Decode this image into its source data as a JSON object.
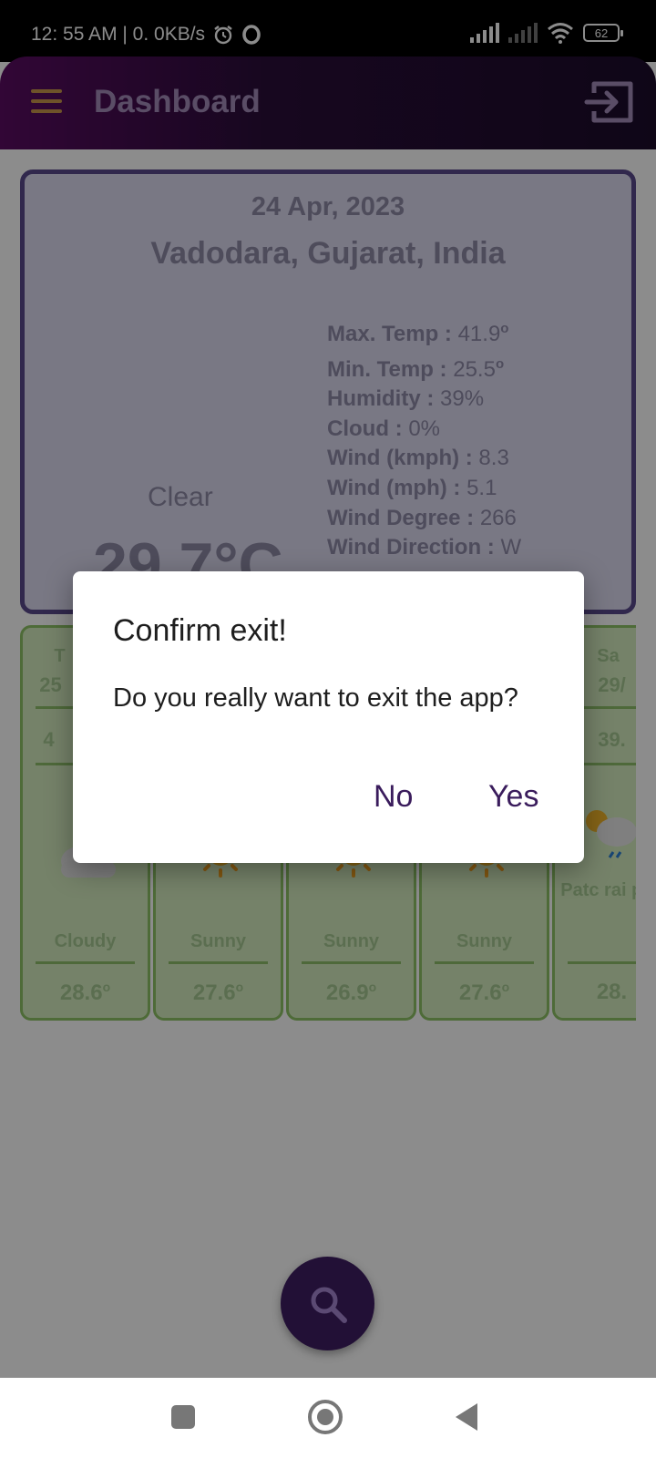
{
  "status_bar": {
    "time_text": "12: 55 AM | 0. 0KB/s",
    "battery": "62"
  },
  "toolbar": {
    "title": "Dashboard"
  },
  "weather": {
    "date": "24 Apr, 2023",
    "location": "Vadodara, Gujarat, India",
    "condition": "Clear",
    "temperature": "29.7°C",
    "stats": [
      {
        "label": "Max. Temp",
        "value": "41.9",
        "degree": "o"
      },
      {
        "label": "Min. Temp",
        "value": "25.5",
        "degree": "o"
      },
      {
        "label": "Humidity",
        "value": "39%"
      },
      {
        "label": "Cloud",
        "value": "0%"
      },
      {
        "label": "Wind (kmph)",
        "value": "8.3"
      },
      {
        "label": "Wind (mph)",
        "value": "5.1"
      },
      {
        "label": "Wind Degree",
        "value": "266"
      },
      {
        "label": "Wind Direction",
        "value": "W"
      }
    ]
  },
  "forecast": [
    {
      "day": "T",
      "date": "25",
      "max": "4",
      "condition": "Cloudy",
      "temp": "28.6",
      "icon": "cloud-icon"
    },
    {
      "day": "",
      "date": "",
      "max": "",
      "condition": "Sunny",
      "temp": "27.6",
      "icon": "sun-icon"
    },
    {
      "day": "",
      "date": "",
      "max": "",
      "condition": "Sunny",
      "temp": "26.9",
      "icon": "sun-icon"
    },
    {
      "day": "",
      "date": "",
      "max": "",
      "condition": "Sunny",
      "temp": "27.6",
      "icon": "sun-icon"
    },
    {
      "day": "Sa",
      "date": "29/",
      "max": "39.",
      "condition": "Patc rai poss",
      "temp": "28.",
      "icon": "patchy-rain-icon"
    }
  ],
  "dialog": {
    "title": "Confirm exit!",
    "message": "Do you really want to exit the app?",
    "no_label": "No",
    "yes_label": "Yes"
  },
  "colors": {
    "toolbar_start": "#5b0b63",
    "toolbar_end": "#1c0c2b",
    "accent": "#3a1c5c",
    "card_border": "#5a4a8c",
    "forecast_border": "#8fc367"
  }
}
